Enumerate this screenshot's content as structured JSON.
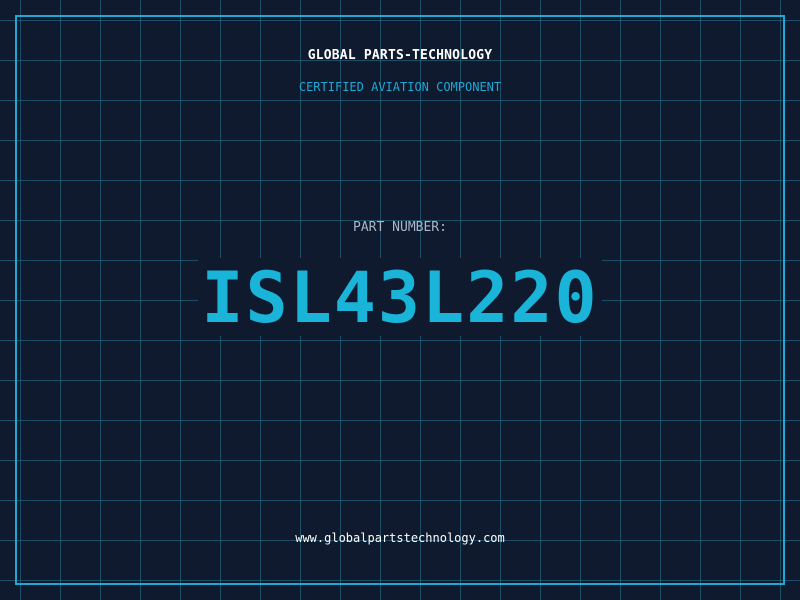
{
  "header": {
    "company": "GLOBAL PARTS-TECHNOLOGY",
    "tagline": "CERTIFIED AVIATION COMPONENT"
  },
  "part": {
    "label": "PART NUMBER:",
    "number": "ISL43L220"
  },
  "footer": {
    "url": "www.globalpartstechnology.com"
  },
  "colors": {
    "background": "#0f1a2e",
    "accent": "#1ea8d4",
    "part_number": "#1ab4d9",
    "label": "#a9b6c9"
  }
}
